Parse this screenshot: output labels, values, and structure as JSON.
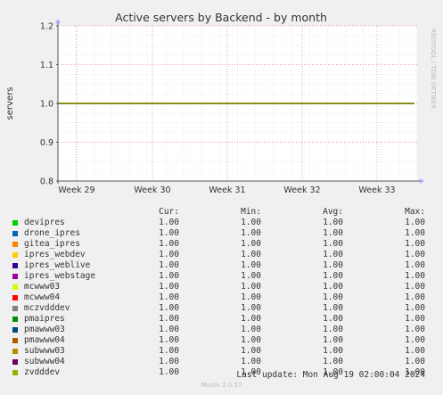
{
  "chart_data": {
    "type": "line",
    "title": "Active servers by Backend - by month",
    "ylabel": "servers",
    "xlabel": "",
    "watermark": "RRDTOOL / TOBI OETIKER",
    "x_ticks": [
      "Week 29",
      "Week 30",
      "Week 31",
      "Week 32",
      "Week 33"
    ],
    "y_ticks": [
      "1.2",
      "1.1",
      "1.0",
      "0.9",
      "0.8"
    ],
    "ylim": [
      0.8,
      1.2
    ],
    "grid": true,
    "series": [
      {
        "name": "devipres",
        "color": "#00cc00",
        "value": 1.0
      },
      {
        "name": "drone_ipres",
        "color": "#0066b3",
        "value": 1.0
      },
      {
        "name": "gitea_ipres",
        "color": "#ff8000",
        "value": 1.0
      },
      {
        "name": "ipres_webdev",
        "color": "#ffcc00",
        "value": 1.0
      },
      {
        "name": "ipres_weblive",
        "color": "#330099",
        "value": 1.0
      },
      {
        "name": "ipres_webstage",
        "color": "#990099",
        "value": 1.0
      },
      {
        "name": "mcwww03",
        "color": "#ccff00",
        "value": 1.0
      },
      {
        "name": "mcwww04",
        "color": "#ff0000",
        "value": 1.0
      },
      {
        "name": "mczvdddev",
        "color": "#808080",
        "value": 1.0
      },
      {
        "name": "pmaipres",
        "color": "#008f00",
        "value": 1.0
      },
      {
        "name": "pmawww03",
        "color": "#00487d",
        "value": 1.0
      },
      {
        "name": "pmawww04",
        "color": "#b35a00",
        "value": 1.0
      },
      {
        "name": "subwww03",
        "color": "#b38f00",
        "value": 1.0
      },
      {
        "name": "subwww04",
        "color": "#6b006b",
        "value": 1.0
      },
      {
        "name": "zvdddev",
        "color": "#8fb300",
        "value": 1.0
      }
    ]
  },
  "legend": {
    "headers": {
      "cur": "Cur:",
      "min": "Min:",
      "avg": "Avg:",
      "max": "Max:"
    },
    "rows": [
      {
        "name": "devipres",
        "cur": "1.00",
        "min": "1.00",
        "avg": "1.00",
        "max": "1.00"
      },
      {
        "name": "drone_ipres",
        "cur": "1.00",
        "min": "1.00",
        "avg": "1.00",
        "max": "1.00"
      },
      {
        "name": "gitea_ipres",
        "cur": "1.00",
        "min": "1.00",
        "avg": "1.00",
        "max": "1.00"
      },
      {
        "name": "ipres_webdev",
        "cur": "1.00",
        "min": "1.00",
        "avg": "1.00",
        "max": "1.00"
      },
      {
        "name": "ipres_weblive",
        "cur": "1.00",
        "min": "1.00",
        "avg": "1.00",
        "max": "1.00"
      },
      {
        "name": "ipres_webstage",
        "cur": "1.00",
        "min": "1.00",
        "avg": "1.00",
        "max": "1.00"
      },
      {
        "name": "mcwww03",
        "cur": "1.00",
        "min": "1.00",
        "avg": "1.00",
        "max": "1.00"
      },
      {
        "name": "mcwww04",
        "cur": "1.00",
        "min": "1.00",
        "avg": "1.00",
        "max": "1.00"
      },
      {
        "name": "mczvdddev",
        "cur": "1.00",
        "min": "1.00",
        "avg": "1.00",
        "max": "1.00"
      },
      {
        "name": "pmaipres",
        "cur": "1.00",
        "min": "1.00",
        "avg": "1.00",
        "max": "1.00"
      },
      {
        "name": "pmawww03",
        "cur": "1.00",
        "min": "1.00",
        "avg": "1.00",
        "max": "1.00"
      },
      {
        "name": "pmawww04",
        "cur": "1.00",
        "min": "1.00",
        "avg": "1.00",
        "max": "1.00"
      },
      {
        "name": "subwww03",
        "cur": "1.00",
        "min": "1.00",
        "avg": "1.00",
        "max": "1.00"
      },
      {
        "name": "subwww04",
        "cur": "1.00",
        "min": "1.00",
        "avg": "1.00",
        "max": "1.00"
      },
      {
        "name": "zvdddev",
        "cur": "1.00",
        "min": "1.00",
        "avg": "1.00",
        "max": "1.00"
      }
    ]
  },
  "last_update": "Last update: Mon Aug 19 02:00:04 2024",
  "footer": "Munin 2.0.57"
}
